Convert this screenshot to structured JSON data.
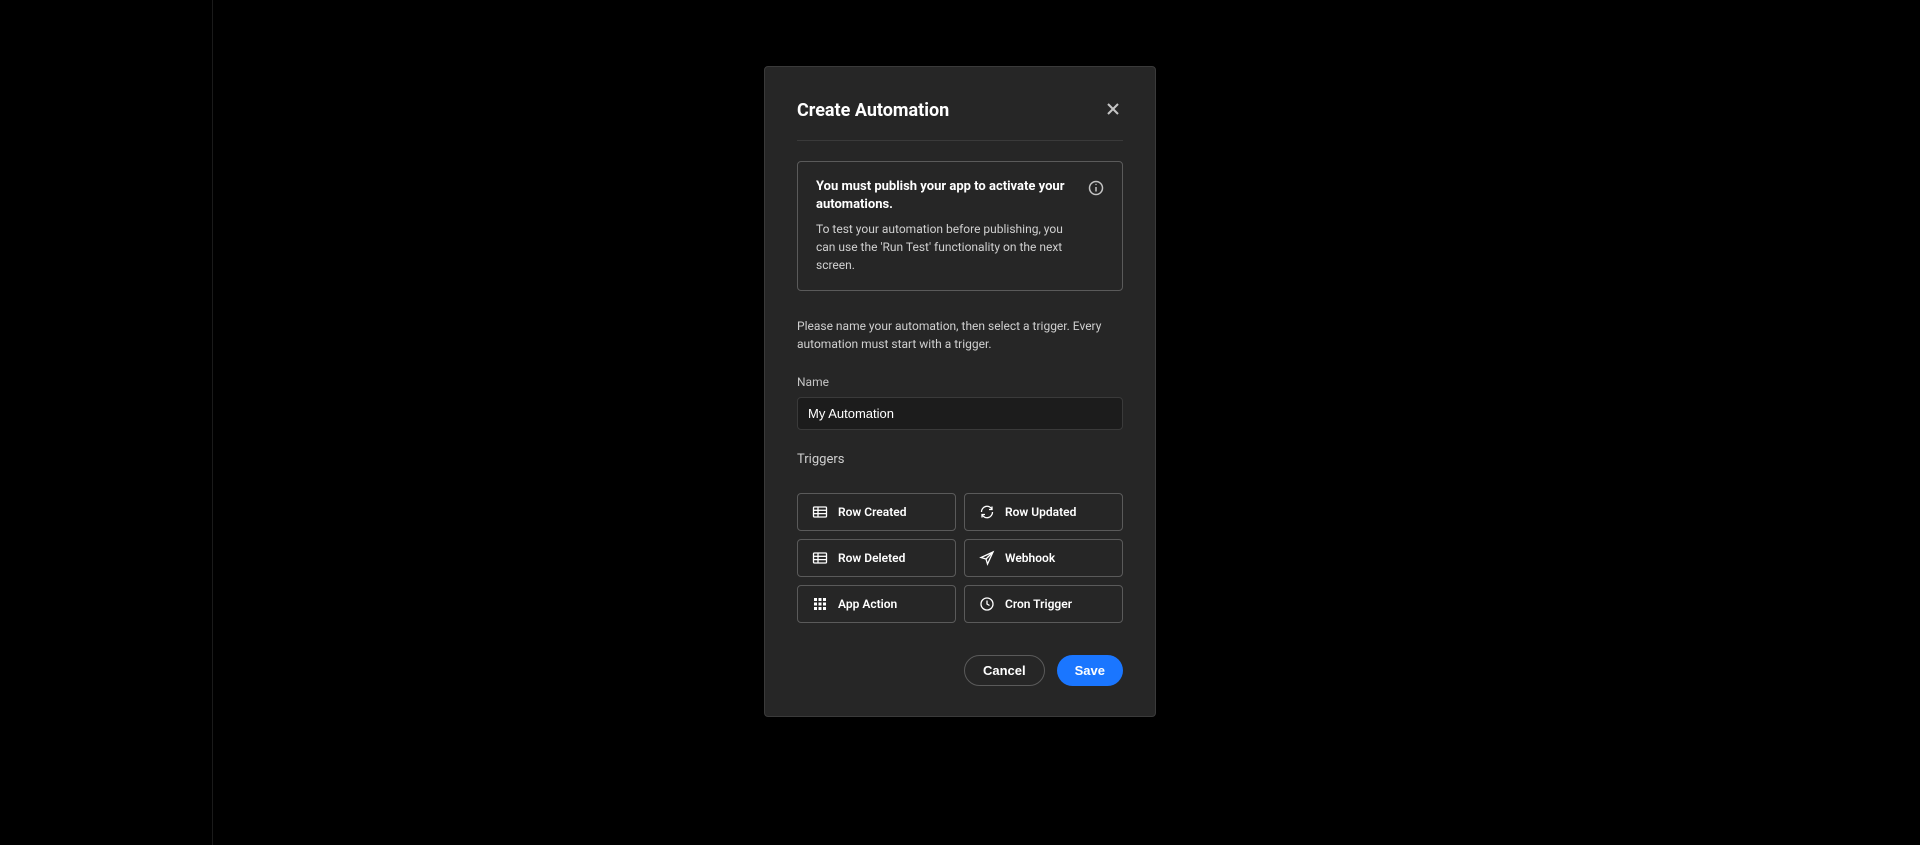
{
  "modal": {
    "title": "Create Automation",
    "info": {
      "title": "You must publish your app to activate your automations.",
      "description": "To test your automation before publishing, you can use the 'Run Test' functionality on the next screen."
    },
    "helper_text": "Please name your automation, then select a trigger. Every automation must start with a trigger.",
    "name_label": "Name",
    "name_value": "My Automation",
    "triggers_label": "Triggers",
    "triggers": [
      {
        "icon": "table-icon",
        "label": "Row Created"
      },
      {
        "icon": "refresh-icon",
        "label": "Row Updated"
      },
      {
        "icon": "table-delete-icon",
        "label": "Row Deleted"
      },
      {
        "icon": "send-icon",
        "label": "Webhook"
      },
      {
        "icon": "grid-icon",
        "label": "App Action"
      },
      {
        "icon": "clock-icon",
        "label": "Cron Trigger"
      }
    ],
    "buttons": {
      "cancel": "Cancel",
      "save": "Save"
    }
  }
}
